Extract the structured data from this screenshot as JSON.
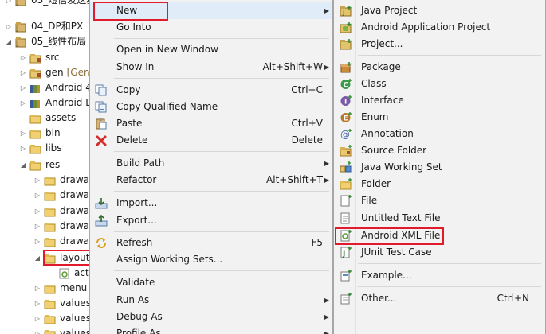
{
  "tree": {
    "items": [
      {
        "label": "03_短信发送器",
        "decoration": "",
        "icon": "project-icon",
        "arrow": "▷"
      },
      {
        "label": "04_DP和PX",
        "decoration": "",
        "icon": "project-icon",
        "arrow": "▷"
      },
      {
        "label": "05_线性布局",
        "decoration": "",
        "icon": "project-icon",
        "arrow": "◢"
      },
      {
        "label": "src",
        "decoration": "",
        "icon": "source-folder-icon",
        "arrow": "▷"
      },
      {
        "label": "gen",
        "decoration": "[Gene",
        "icon": "source-folder-icon",
        "arrow": "▷"
      },
      {
        "label": "Android 4",
        "decoration": "",
        "icon": "library-icon",
        "arrow": "▷"
      },
      {
        "label": "Android D",
        "decoration": "",
        "icon": "library-icon",
        "arrow": "▷"
      },
      {
        "label": "assets",
        "decoration": "",
        "icon": "folder-icon",
        "arrow": ""
      },
      {
        "label": "bin",
        "decoration": "",
        "icon": "folder-icon",
        "arrow": "▷"
      },
      {
        "label": "libs",
        "decoration": "",
        "icon": "folder-icon",
        "arrow": "▷"
      },
      {
        "label": "res",
        "decoration": "",
        "icon": "folder-icon",
        "arrow": "◢"
      },
      {
        "label": "drawa",
        "decoration": "",
        "icon": "folder-icon",
        "arrow": "▷"
      },
      {
        "label": "drawa",
        "decoration": "",
        "icon": "folder-icon",
        "arrow": "▷"
      },
      {
        "label": "drawa",
        "decoration": "",
        "icon": "folder-icon",
        "arrow": "▷"
      },
      {
        "label": "drawa",
        "decoration": "",
        "icon": "folder-icon",
        "arrow": "▷"
      },
      {
        "label": "drawa",
        "decoration": "",
        "icon": "folder-icon",
        "arrow": "▷"
      },
      {
        "label": "layout",
        "decoration": "",
        "icon": "folder-icon",
        "arrow": "◢"
      },
      {
        "label": "act",
        "decoration": "",
        "icon": "xml-file-icon",
        "arrow": ""
      },
      {
        "label": "menu",
        "decoration": "",
        "icon": "folder-icon",
        "arrow": "▷"
      },
      {
        "label": "values",
        "decoration": "",
        "icon": "folder-icon",
        "arrow": "▷"
      },
      {
        "label": "values",
        "decoration": "",
        "icon": "folder-icon",
        "arrow": "▷"
      },
      {
        "label": "values",
        "decoration": "",
        "icon": "folder-icon",
        "arrow": "▷"
      }
    ]
  },
  "context_menu": {
    "items": [
      {
        "label": "New",
        "accelerator": "",
        "submenu": true,
        "icon": ""
      },
      {
        "label": "Go Into",
        "accelerator": "",
        "submenu": false,
        "icon": ""
      },
      {
        "label": "Open in New Window",
        "accelerator": "",
        "submenu": false,
        "icon": ""
      },
      {
        "label": "Show In",
        "accelerator": "Alt+Shift+W",
        "submenu": true,
        "icon": ""
      },
      {
        "label": "Copy",
        "accelerator": "Ctrl+C",
        "submenu": false,
        "icon": "copy-icon"
      },
      {
        "label": "Copy Qualified Name",
        "accelerator": "",
        "submenu": false,
        "icon": "copy-qualified-icon"
      },
      {
        "label": "Paste",
        "accelerator": "Ctrl+V",
        "submenu": false,
        "icon": "paste-icon"
      },
      {
        "label": "Delete",
        "accelerator": "Delete",
        "submenu": false,
        "icon": "delete-icon"
      },
      {
        "label": "Build Path",
        "accelerator": "",
        "submenu": true,
        "icon": ""
      },
      {
        "label": "Refactor",
        "accelerator": "Alt+Shift+T",
        "submenu": true,
        "icon": ""
      },
      {
        "label": "Import...",
        "accelerator": "",
        "submenu": false,
        "icon": "import-icon"
      },
      {
        "label": "Export...",
        "accelerator": "",
        "submenu": false,
        "icon": "export-icon"
      },
      {
        "label": "Refresh",
        "accelerator": "F5",
        "submenu": false,
        "icon": "refresh-icon"
      },
      {
        "label": "Assign Working Sets...",
        "accelerator": "",
        "submenu": false,
        "icon": ""
      },
      {
        "label": "Validate",
        "accelerator": "",
        "submenu": false,
        "icon": ""
      },
      {
        "label": "Run As",
        "accelerator": "",
        "submenu": true,
        "icon": ""
      },
      {
        "label": "Debug As",
        "accelerator": "",
        "submenu": true,
        "icon": ""
      },
      {
        "label": "Profile As",
        "accelerator": "",
        "submenu": true,
        "icon": ""
      }
    ]
  },
  "new_submenu": {
    "items": [
      {
        "label": "Java Project",
        "accelerator": "",
        "icon": "java-project-icon"
      },
      {
        "label": "Android Application Project",
        "accelerator": "",
        "icon": "android-project-icon"
      },
      {
        "label": "Project...",
        "accelerator": "",
        "icon": "project-wizard-icon"
      },
      {
        "label": "Package",
        "accelerator": "",
        "icon": "package-icon"
      },
      {
        "label": "Class",
        "accelerator": "",
        "icon": "class-icon"
      },
      {
        "label": "Interface",
        "accelerator": "",
        "icon": "interface-icon"
      },
      {
        "label": "Enum",
        "accelerator": "",
        "icon": "enum-icon"
      },
      {
        "label": "Annotation",
        "accelerator": "",
        "icon": "annotation-icon"
      },
      {
        "label": "Source Folder",
        "accelerator": "",
        "icon": "source-folder-icon"
      },
      {
        "label": "Java Working Set",
        "accelerator": "",
        "icon": "working-set-icon"
      },
      {
        "label": "Folder",
        "accelerator": "",
        "icon": "folder-icon"
      },
      {
        "label": "File",
        "accelerator": "",
        "icon": "file-icon"
      },
      {
        "label": "Untitled Text File",
        "accelerator": "",
        "icon": "text-file-icon"
      },
      {
        "label": "Android XML File",
        "accelerator": "",
        "icon": "android-xml-icon"
      },
      {
        "label": "JUnit Test Case",
        "accelerator": "",
        "icon": "junit-icon"
      },
      {
        "label": "Example...",
        "accelerator": "",
        "icon": "example-icon"
      },
      {
        "label": "Other...",
        "accelerator": "Ctrl+N",
        "icon": "other-wizard-icon"
      }
    ]
  },
  "colors": {
    "highlight_border": "#e21b2c",
    "menu_bg": "#f2f2f2",
    "menu_border": "#a8a8a8",
    "hover_bg": "#e0ecf8"
  }
}
